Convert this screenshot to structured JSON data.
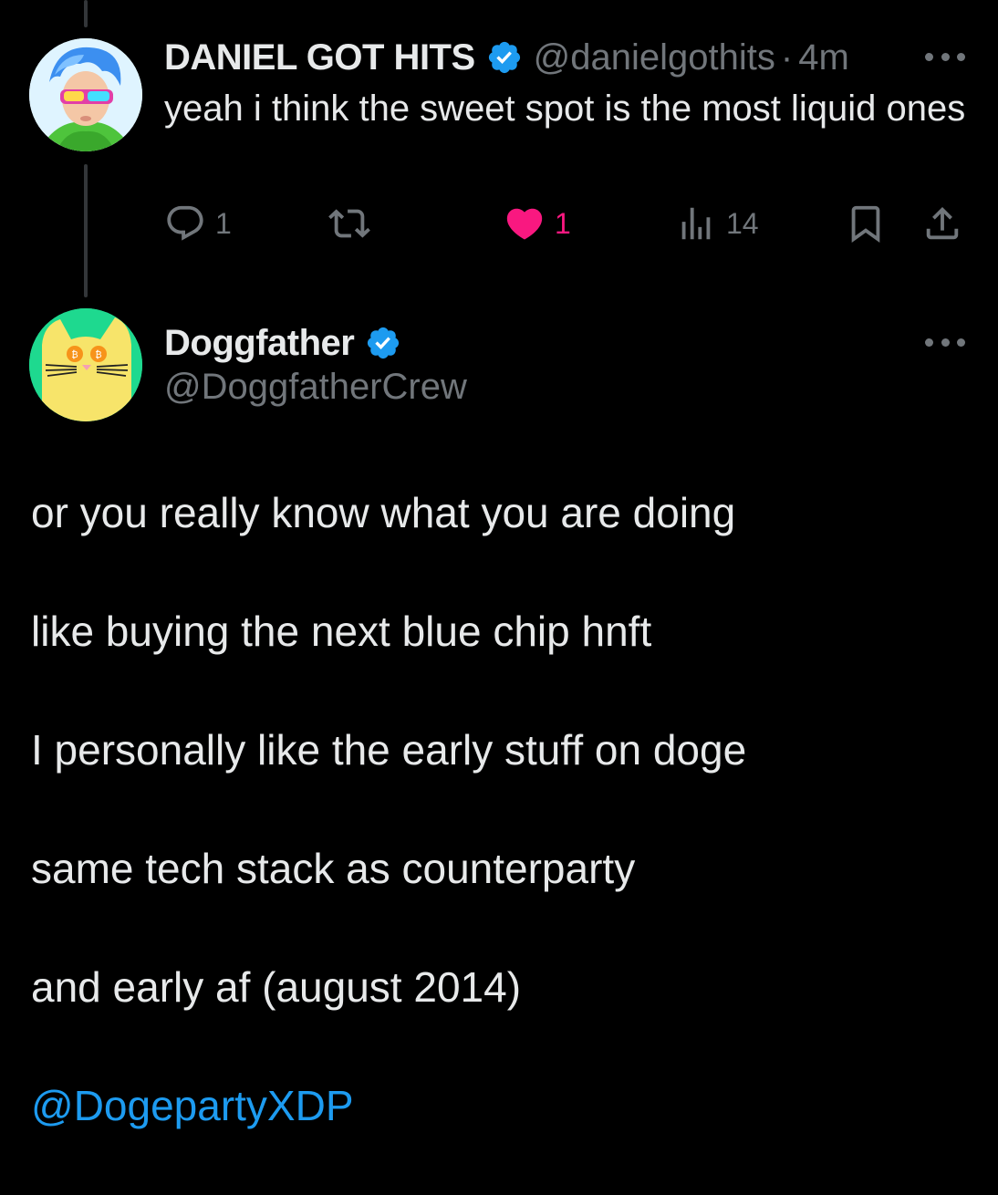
{
  "tweet1": {
    "author_name": "DANIEL GOT HITS",
    "handle": "@danielgothits",
    "separator": "·",
    "time": "4m",
    "text": "yeah i think the sweet spot is the most liquid ones",
    "actions": {
      "replies": "1",
      "retweets": "",
      "likes": "1",
      "views": "14"
    }
  },
  "tweet2": {
    "author_name": "Doggfather",
    "handle": "@DoggfatherCrew",
    "paragraphs": [
      "or you really know what you are doing",
      "like buying the next blue chip hnft",
      "I personally like the early stuff on doge",
      "same tech stack as counterparty",
      "and early af (august 2014)"
    ],
    "mention": "@DogepartyXDP"
  },
  "icons": {
    "verified": "verified-badge-icon",
    "reply": "reply-icon",
    "retweet": "retweet-icon",
    "like": "heart-icon",
    "views": "views-icon",
    "bookmark": "bookmark-icon",
    "share": "share-icon",
    "more": "more-icon"
  },
  "colors": {
    "background": "#000000",
    "text": "#e7e9ea",
    "muted": "#71767b",
    "accent": "#1d9bf0",
    "like": "#f91880"
  }
}
